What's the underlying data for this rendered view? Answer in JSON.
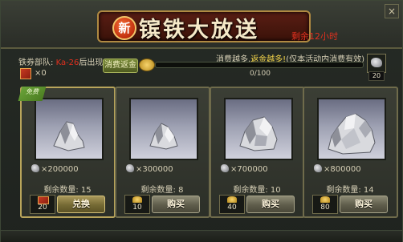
{
  "header": {
    "badge": "新",
    "title": "镔铁大放送",
    "time_left": "剩余12小时",
    "close": "×"
  },
  "info": {
    "coupon_note_prefix": "铁券部队: ",
    "coupon_note_red": "Ka-26",
    "coupon_note_suffix": "后出现",
    "coupon_count": "×0"
  },
  "rebate": {
    "label": "消费返金",
    "hint_prefix": "消费越多,",
    "hint_gold": "返金越多!",
    "hint_suffix": "(仅本活动内消费有效)",
    "progress_text": "0/100",
    "progress_fraction": 0,
    "reward_count": "20"
  },
  "cards": [
    {
      "ribbon": "免费",
      "qty": "×200000",
      "remain": "剩余数量: 15",
      "price": "20",
      "price_icon": "coupon-icon",
      "action": "兑换"
    },
    {
      "ribbon": "",
      "qty": "×300000",
      "remain": "剩余数量: 8",
      "price": "10",
      "price_icon": "gold-ingot-icon",
      "action": "购买"
    },
    {
      "ribbon": "",
      "qty": "×700000",
      "remain": "剩余数量: 10",
      "price": "40",
      "price_icon": "gold-ingot-icon",
      "action": "购买"
    },
    {
      "ribbon": "",
      "qty": "×800000",
      "remain": "剩余数量: 14",
      "price": "80",
      "price_icon": "gold-ingot-icon",
      "action": "购买"
    }
  ]
}
